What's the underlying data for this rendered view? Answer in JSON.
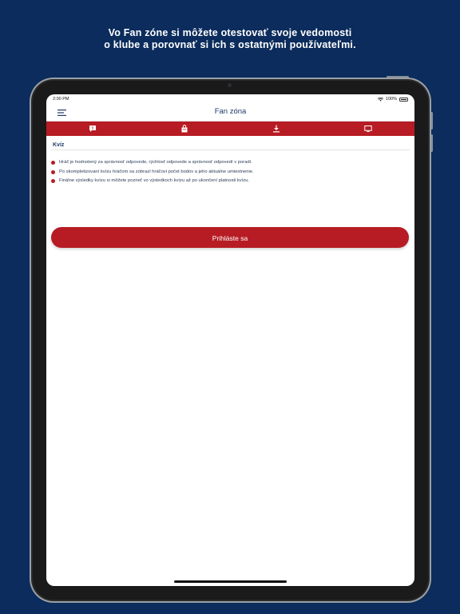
{
  "promo": {
    "line1": "Vo Fan zóne si môžete otestovať svoje vedomosti",
    "line2": "o klube a porovnať si ich s ostatnými používateľmi."
  },
  "status": {
    "time": "2:00 PM",
    "battery": "100%"
  },
  "header": {
    "title": "Fan zóna",
    "menu_icon": "menu-icon"
  },
  "tabs": [
    {
      "icon": "quiz-chat-icon"
    },
    {
      "icon": "shop-bag-icon"
    },
    {
      "icon": "download-icon"
    },
    {
      "icon": "tv-icon"
    }
  ],
  "quiz": {
    "title": "Kvíz",
    "rules": [
      "Hráč je hodnotený za správnosť odpovede, rýchlosť odpovede a správnosť odpovedí v poradí.",
      "Po skompletizovaní kvízu hráčom sa zobrazí hráčovi počet bodov a jeho aktuálne umiestnenie.",
      "Finálne výsledky kvízu si môžete pozrieť vo výsledkoch kvízu až po ukončení platnosti kvízu."
    ],
    "login_label": "Prihláste sa"
  },
  "colors": {
    "background": "#0b2c5c",
    "brand_red": "#b71c24",
    "title_blue": "#1f3a66"
  }
}
